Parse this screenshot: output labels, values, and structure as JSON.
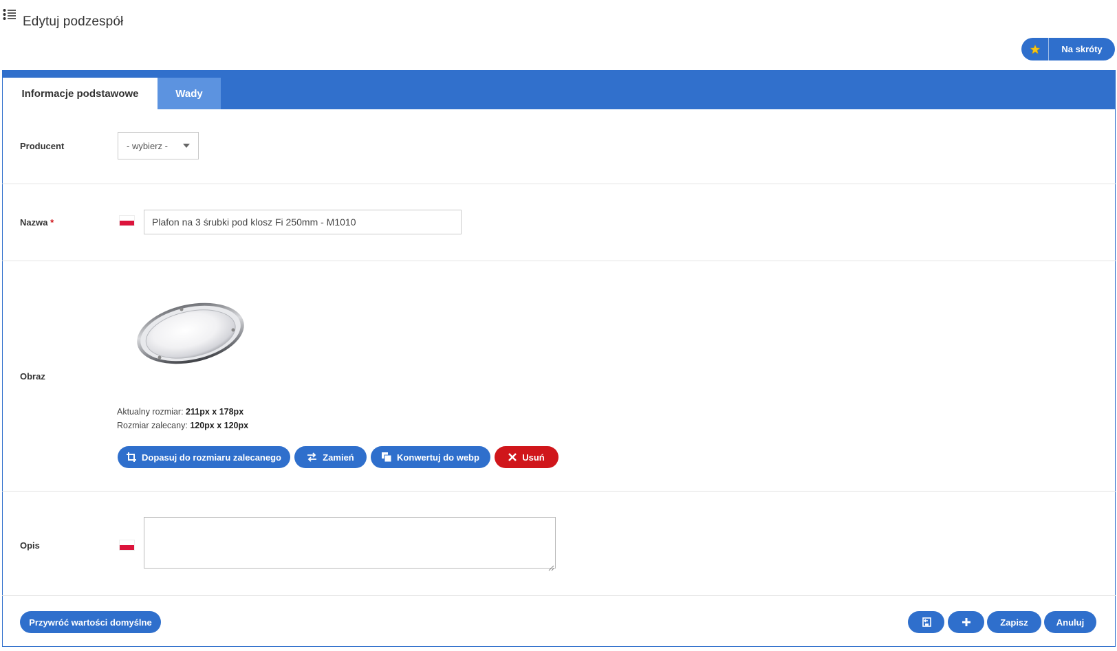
{
  "header": {
    "title": "Edytuj podzespół",
    "shortcuts_label": "Na skróty",
    "star_color": "#f5c518"
  },
  "tabs": [
    {
      "label": "Informacje podstawowe",
      "active": true
    },
    {
      "label": "Wady",
      "active": false
    }
  ],
  "form": {
    "producer": {
      "label": "Producent",
      "value": "- wybierz -"
    },
    "name": {
      "label": "Nazwa",
      "required_mark": "*",
      "value": "Plafon na 3 śrubki pod klosz Fi 250mm - M1010",
      "language": "pl"
    },
    "image": {
      "label": "Obraz",
      "current_size_label": "Aktualny rozmiar:",
      "current_size_value": "211px x 178px",
      "recommended_size_label": "Rozmiar zalecany:",
      "recommended_size_value": "120px x 120px",
      "buttons": {
        "fit": "Dopasuj do rozmiaru zalecanego",
        "replace": "Zamień",
        "convert": "Konwertuj do webp",
        "delete": "Usuń"
      }
    },
    "description": {
      "label": "Opis",
      "value": "",
      "language": "pl"
    }
  },
  "footer": {
    "restore_defaults": "Przywróć wartości domyślne",
    "save": "Zapisz",
    "cancel": "Anuluj",
    "save_and_new_icon": "plus-icon",
    "save_and_back_icon": "save-return-icon"
  },
  "colors": {
    "primary": "#2f6fcc",
    "danger": "#d0161b",
    "tab_inactive": "#5c93e0"
  }
}
